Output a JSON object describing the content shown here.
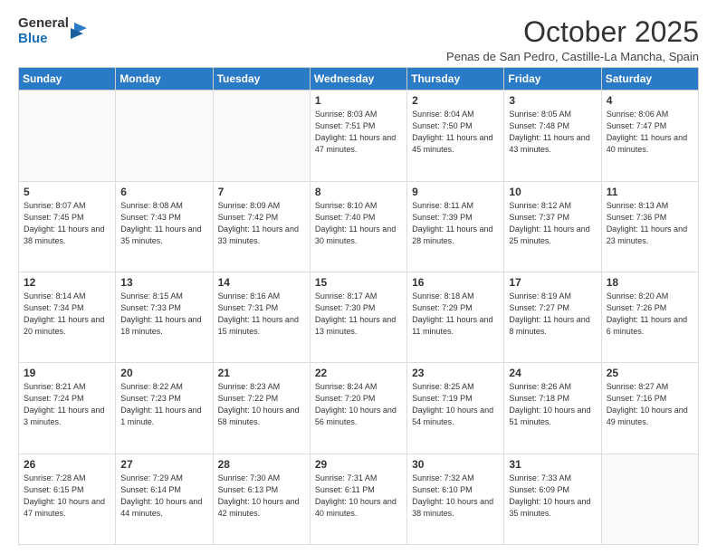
{
  "logo": {
    "general": "General",
    "blue": "Blue"
  },
  "title": "October 2025",
  "location": "Penas de San Pedro, Castille-La Mancha, Spain",
  "weekdays": [
    "Sunday",
    "Monday",
    "Tuesday",
    "Wednesday",
    "Thursday",
    "Friday",
    "Saturday"
  ],
  "weeks": [
    [
      {
        "day": "",
        "info": ""
      },
      {
        "day": "",
        "info": ""
      },
      {
        "day": "",
        "info": ""
      },
      {
        "day": "1",
        "info": "Sunrise: 8:03 AM\nSunset: 7:51 PM\nDaylight: 11 hours\nand 47 minutes."
      },
      {
        "day": "2",
        "info": "Sunrise: 8:04 AM\nSunset: 7:50 PM\nDaylight: 11 hours\nand 45 minutes."
      },
      {
        "day": "3",
        "info": "Sunrise: 8:05 AM\nSunset: 7:48 PM\nDaylight: 11 hours\nand 43 minutes."
      },
      {
        "day": "4",
        "info": "Sunrise: 8:06 AM\nSunset: 7:47 PM\nDaylight: 11 hours\nand 40 minutes."
      }
    ],
    [
      {
        "day": "5",
        "info": "Sunrise: 8:07 AM\nSunset: 7:45 PM\nDaylight: 11 hours\nand 38 minutes."
      },
      {
        "day": "6",
        "info": "Sunrise: 8:08 AM\nSunset: 7:43 PM\nDaylight: 11 hours\nand 35 minutes."
      },
      {
        "day": "7",
        "info": "Sunrise: 8:09 AM\nSunset: 7:42 PM\nDaylight: 11 hours\nand 33 minutes."
      },
      {
        "day": "8",
        "info": "Sunrise: 8:10 AM\nSunset: 7:40 PM\nDaylight: 11 hours\nand 30 minutes."
      },
      {
        "day": "9",
        "info": "Sunrise: 8:11 AM\nSunset: 7:39 PM\nDaylight: 11 hours\nand 28 minutes."
      },
      {
        "day": "10",
        "info": "Sunrise: 8:12 AM\nSunset: 7:37 PM\nDaylight: 11 hours\nand 25 minutes."
      },
      {
        "day": "11",
        "info": "Sunrise: 8:13 AM\nSunset: 7:36 PM\nDaylight: 11 hours\nand 23 minutes."
      }
    ],
    [
      {
        "day": "12",
        "info": "Sunrise: 8:14 AM\nSunset: 7:34 PM\nDaylight: 11 hours\nand 20 minutes."
      },
      {
        "day": "13",
        "info": "Sunrise: 8:15 AM\nSunset: 7:33 PM\nDaylight: 11 hours\nand 18 minutes."
      },
      {
        "day": "14",
        "info": "Sunrise: 8:16 AM\nSunset: 7:31 PM\nDaylight: 11 hours\nand 15 minutes."
      },
      {
        "day": "15",
        "info": "Sunrise: 8:17 AM\nSunset: 7:30 PM\nDaylight: 11 hours\nand 13 minutes."
      },
      {
        "day": "16",
        "info": "Sunrise: 8:18 AM\nSunset: 7:29 PM\nDaylight: 11 hours\nand 11 minutes."
      },
      {
        "day": "17",
        "info": "Sunrise: 8:19 AM\nSunset: 7:27 PM\nDaylight: 11 hours\nand 8 minutes."
      },
      {
        "day": "18",
        "info": "Sunrise: 8:20 AM\nSunset: 7:26 PM\nDaylight: 11 hours\nand 6 minutes."
      }
    ],
    [
      {
        "day": "19",
        "info": "Sunrise: 8:21 AM\nSunset: 7:24 PM\nDaylight: 11 hours\nand 3 minutes."
      },
      {
        "day": "20",
        "info": "Sunrise: 8:22 AM\nSunset: 7:23 PM\nDaylight: 11 hours\nand 1 minute."
      },
      {
        "day": "21",
        "info": "Sunrise: 8:23 AM\nSunset: 7:22 PM\nDaylight: 10 hours\nand 58 minutes."
      },
      {
        "day": "22",
        "info": "Sunrise: 8:24 AM\nSunset: 7:20 PM\nDaylight: 10 hours\nand 56 minutes."
      },
      {
        "day": "23",
        "info": "Sunrise: 8:25 AM\nSunset: 7:19 PM\nDaylight: 10 hours\nand 54 minutes."
      },
      {
        "day": "24",
        "info": "Sunrise: 8:26 AM\nSunset: 7:18 PM\nDaylight: 10 hours\nand 51 minutes."
      },
      {
        "day": "25",
        "info": "Sunrise: 8:27 AM\nSunset: 7:16 PM\nDaylight: 10 hours\nand 49 minutes."
      }
    ],
    [
      {
        "day": "26",
        "info": "Sunrise: 7:28 AM\nSunset: 6:15 PM\nDaylight: 10 hours\nand 47 minutes."
      },
      {
        "day": "27",
        "info": "Sunrise: 7:29 AM\nSunset: 6:14 PM\nDaylight: 10 hours\nand 44 minutes."
      },
      {
        "day": "28",
        "info": "Sunrise: 7:30 AM\nSunset: 6:13 PM\nDaylight: 10 hours\nand 42 minutes."
      },
      {
        "day": "29",
        "info": "Sunrise: 7:31 AM\nSunset: 6:11 PM\nDaylight: 10 hours\nand 40 minutes."
      },
      {
        "day": "30",
        "info": "Sunrise: 7:32 AM\nSunset: 6:10 PM\nDaylight: 10 hours\nand 38 minutes."
      },
      {
        "day": "31",
        "info": "Sunrise: 7:33 AM\nSunset: 6:09 PM\nDaylight: 10 hours\nand 35 minutes."
      },
      {
        "day": "",
        "info": ""
      }
    ]
  ]
}
